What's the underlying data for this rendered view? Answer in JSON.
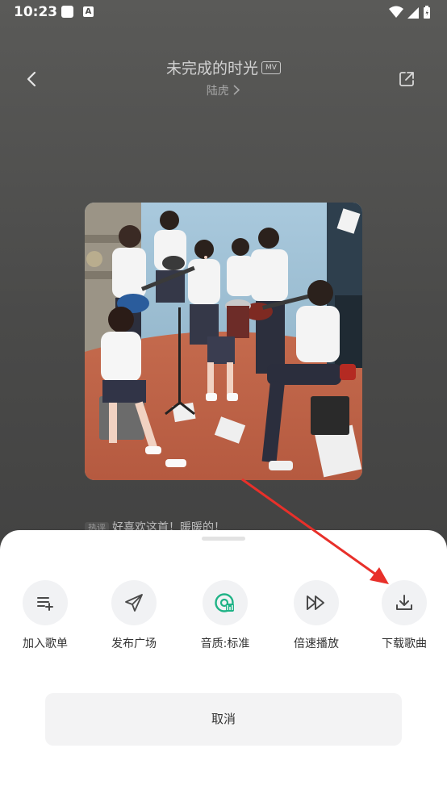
{
  "status_bar": {
    "time": "10:23",
    "notif_letter": "A"
  },
  "header": {
    "title": "未完成的时光",
    "mv_badge": "MV",
    "artist": "陆虎"
  },
  "hot_comment": {
    "tag": "热评",
    "text": "好喜欢这首！暖暖的！"
  },
  "sheet": {
    "actions": [
      {
        "label": "加入歌单",
        "icon": "add-to-playlist-icon"
      },
      {
        "label": "发布广场",
        "icon": "send-icon"
      },
      {
        "label": "音质:标准",
        "icon": "sound-quality-icon"
      },
      {
        "label": "倍速播放",
        "icon": "fast-forward-icon"
      },
      {
        "label": "下载歌曲",
        "icon": "download-icon"
      }
    ],
    "cancel_label": "取消"
  },
  "colors": {
    "accent_green": "#1fb386",
    "annotation_red": "#e8302a"
  }
}
